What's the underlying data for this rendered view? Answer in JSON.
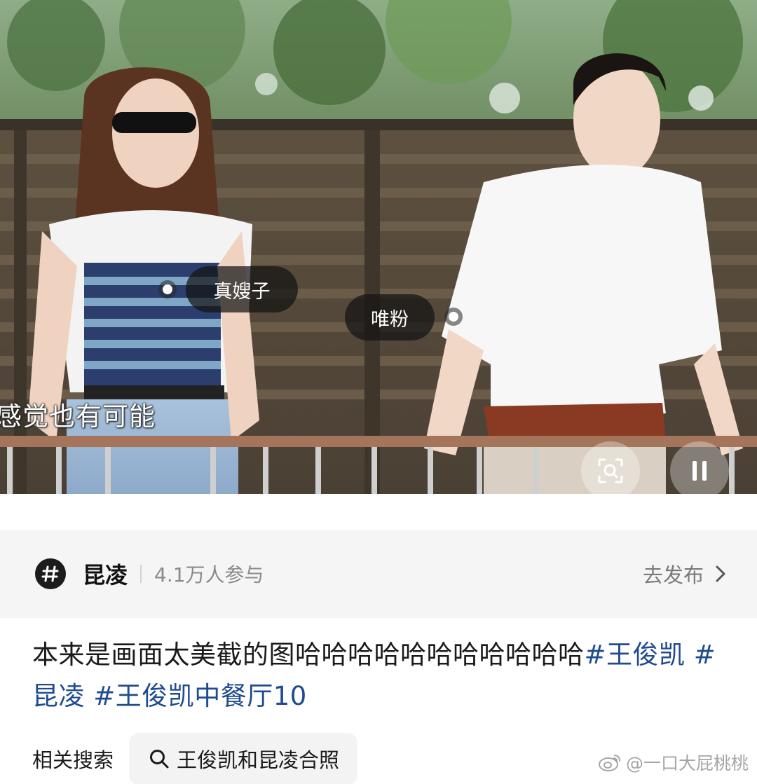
{
  "video": {
    "tags": [
      {
        "label": "真嫂子"
      },
      {
        "label": "唯粉"
      }
    ],
    "subtitle": "感觉也有可能",
    "lens_button_icon": "image-search-icon",
    "pause_button_icon": "pause-icon"
  },
  "topic": {
    "icon": "hashtag-bubble-icon",
    "name": "昆凌",
    "participants": "4.1万人参与",
    "action_label": "去发布",
    "action_icon": "chevron-right-icon"
  },
  "post": {
    "text": "本来是画面太美截的图哈哈哈哈哈哈哈哈哈哈哈",
    "hashtags": [
      "#王俊凯",
      "#昆凌",
      "#王俊凯中餐厅10"
    ]
  },
  "related": {
    "label": "相关搜索",
    "chip_icon": "search-icon",
    "chip_text": "王俊凯和昆凌合照"
  },
  "watermark": {
    "icon": "weibo-logo-icon",
    "text": "@一口大屁桃桃"
  },
  "colors": {
    "hashtag": "#1f4b8f",
    "topic_bar_bg": "#f5f5f5",
    "chip_bg": "#f3f3f3"
  }
}
